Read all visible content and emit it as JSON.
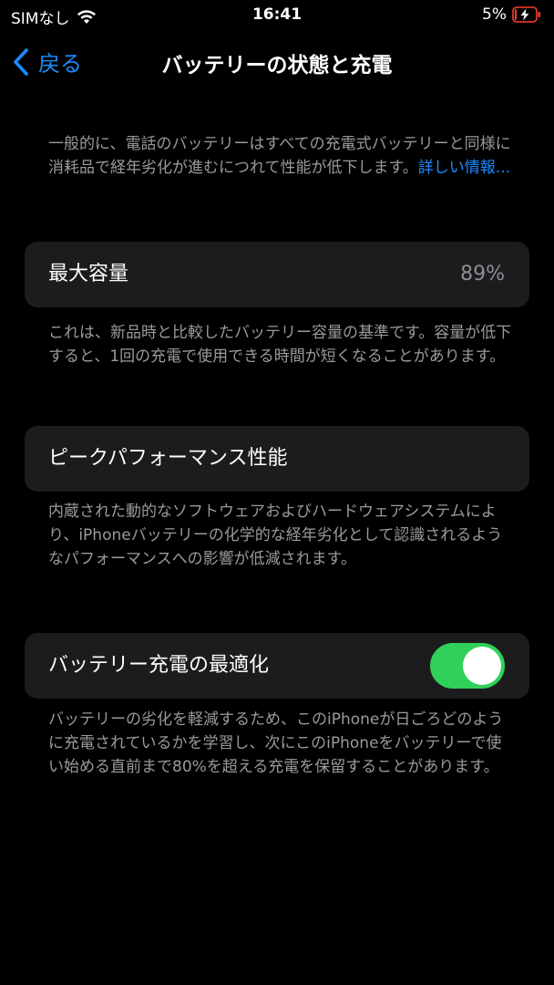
{
  "status_bar": {
    "carrier": "SIMなし",
    "time": "16:41",
    "battery_percent": "5%",
    "battery_level": 0.05,
    "charging": true,
    "icons": [
      "wifi-icon",
      "battery-charging-icon"
    ]
  },
  "nav": {
    "back_label": "戻る",
    "title": "バッテリーの状態と充電"
  },
  "intro": {
    "text": "一般的に、電話のバッテリーはすべての充電式バッテリーと同様に消耗品で経年劣化が進むにつれて性能が低下します。",
    "link": "詳しい情報..."
  },
  "max_capacity": {
    "label": "最大容量",
    "value": "89%",
    "description": "これは、新品時と比較したバッテリー容量の基準です。容量が低下すると、1回の充電で使用できる時間が短くなることがあります。"
  },
  "peak_performance": {
    "label": "ピークパフォーマンス性能",
    "description": "内蔵された動的なソフトウェアおよびハードウェアシステムにより、iPhoneバッテリーの化学的な経年劣化として認識されるようなパフォーマンスへの影響が低減されます。"
  },
  "optimized_charging": {
    "label": "バッテリー充電の最適化",
    "enabled": true,
    "description": "バッテリーの劣化を軽減するため、このiPhoneが日ごろどのように充電されているかを学習し、次にこのiPhoneをバッテリーで使い始める直前まで80%を超える充電を保留することがあります。"
  },
  "colors": {
    "background": "#000000",
    "card": "#1c1c1e",
    "accent": "#1a8cff",
    "toggle_on": "#30d158",
    "secondary_text": "#9a9a9f",
    "battery_low": "#ff3b30"
  }
}
